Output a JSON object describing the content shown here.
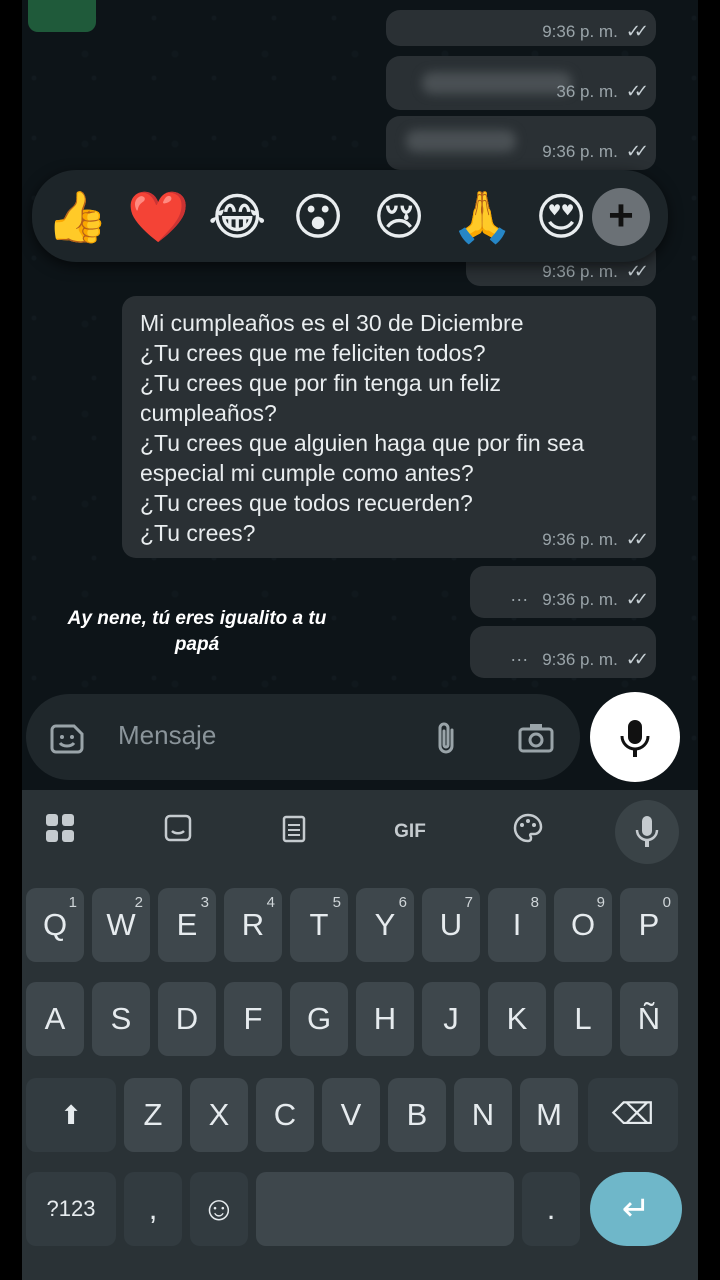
{
  "messages": {
    "top_partial": {
      "time": "9:36 p. m."
    },
    "blurred_1": {
      "time": "36 p. m."
    },
    "blurred_2": {
      "time": "9:36 p. m."
    },
    "under_reactions": {
      "time": "9:36 p. m."
    },
    "main": {
      "text": "Mi cumpleaños es el 30 de Diciembre\n¿Tu crees que me feliciten todos?\n¿Tu crees que por fin tenga un feliz cumpleaños?\n¿Tu crees que alguien haga que por fin sea especial mi cumple como antes?\n¿Tu crees que todos recuerden?\n¿Tu crees?",
      "time": "9:36 p. m."
    },
    "dots_1": {
      "text": "···",
      "time": "9:36 p. m."
    },
    "dots_2": {
      "text": "···",
      "time": "9:36 p. m."
    },
    "tick_glyph": "✓✓"
  },
  "reactions": [
    "👍",
    "❤️",
    "😂",
    "😮",
    "😢",
    "🙏",
    "😍"
  ],
  "reaction_more": "+",
  "caption": "Ay nene, tú eres igualito a tu papá",
  "input": {
    "placeholder": "Mensaje"
  },
  "keyboard": {
    "toolbar": {
      "gif": "GIF"
    },
    "row1": [
      {
        "k": "Q",
        "n": "1"
      },
      {
        "k": "W",
        "n": "2"
      },
      {
        "k": "E",
        "n": "3"
      },
      {
        "k": "R",
        "n": "4"
      },
      {
        "k": "T",
        "n": "5"
      },
      {
        "k": "Y",
        "n": "6"
      },
      {
        "k": "U",
        "n": "7"
      },
      {
        "k": "I",
        "n": "8"
      },
      {
        "k": "O",
        "n": "9"
      },
      {
        "k": "P",
        "n": "0"
      }
    ],
    "row2": [
      "A",
      "S",
      "D",
      "F",
      "G",
      "H",
      "J",
      "K",
      "L",
      "Ñ"
    ],
    "row3": [
      "Z",
      "X",
      "C",
      "V",
      "B",
      "N",
      "M"
    ],
    "symbols": "?123",
    "comma": ",",
    "emoji": "☺",
    "period": ".",
    "enter": "↵",
    "shift": "⬆",
    "backspace": "⌫"
  },
  "colors": {
    "bubble": "#2a3034",
    "background": "#0b141a",
    "keyboard": "#2a3236",
    "enter": "#6fb7c9"
  }
}
